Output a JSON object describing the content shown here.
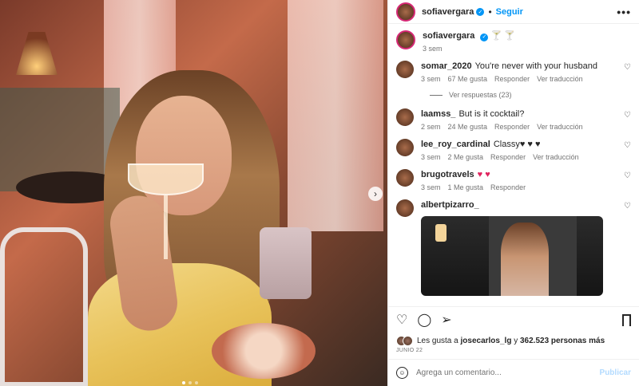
{
  "post": {
    "author": "sofiavergara",
    "follow_label": "Seguir",
    "more_label": "•••",
    "caption": "🍸 🍸",
    "caption_time": "3 sem"
  },
  "comments": [
    {
      "user": "somar_2020",
      "text": "You're never with your husband",
      "time": "3 sem",
      "likes": "67 Me gusta",
      "reply": "Responder",
      "translate": "Ver traducción"
    },
    {
      "user": "laamss_",
      "text": "But is it cocktail?",
      "time": "2 sem",
      "likes": "24 Me gusta",
      "reply": "Responder",
      "translate": "Ver traducción"
    },
    {
      "user": "lee_roy_cardinal",
      "text": "Classy♥ ♥ ♥",
      "time": "3 sem",
      "likes": "2 Me gusta",
      "reply": "Responder",
      "translate": "Ver traducción"
    },
    {
      "user": "brugotravels",
      "text": "♥ ♥",
      "time": "3 sem",
      "likes": "1 Me gusta",
      "reply": "Responder"
    },
    {
      "user": "albertpizarro_",
      "text": ""
    }
  ],
  "replies_label": "Ver respuestas (23)",
  "likes": {
    "prefix": "Les gusta a",
    "user": "josecarlos_lg",
    "middle": "y",
    "count": "362.523 personas más"
  },
  "date": "JUNIO 22",
  "composer": {
    "placeholder": "Agrega un comentario...",
    "post_label": "Publicar"
  },
  "icons": [
    "verified-badge",
    "heart",
    "comment",
    "share",
    "bookmark",
    "emoji",
    "chevron-right"
  ]
}
